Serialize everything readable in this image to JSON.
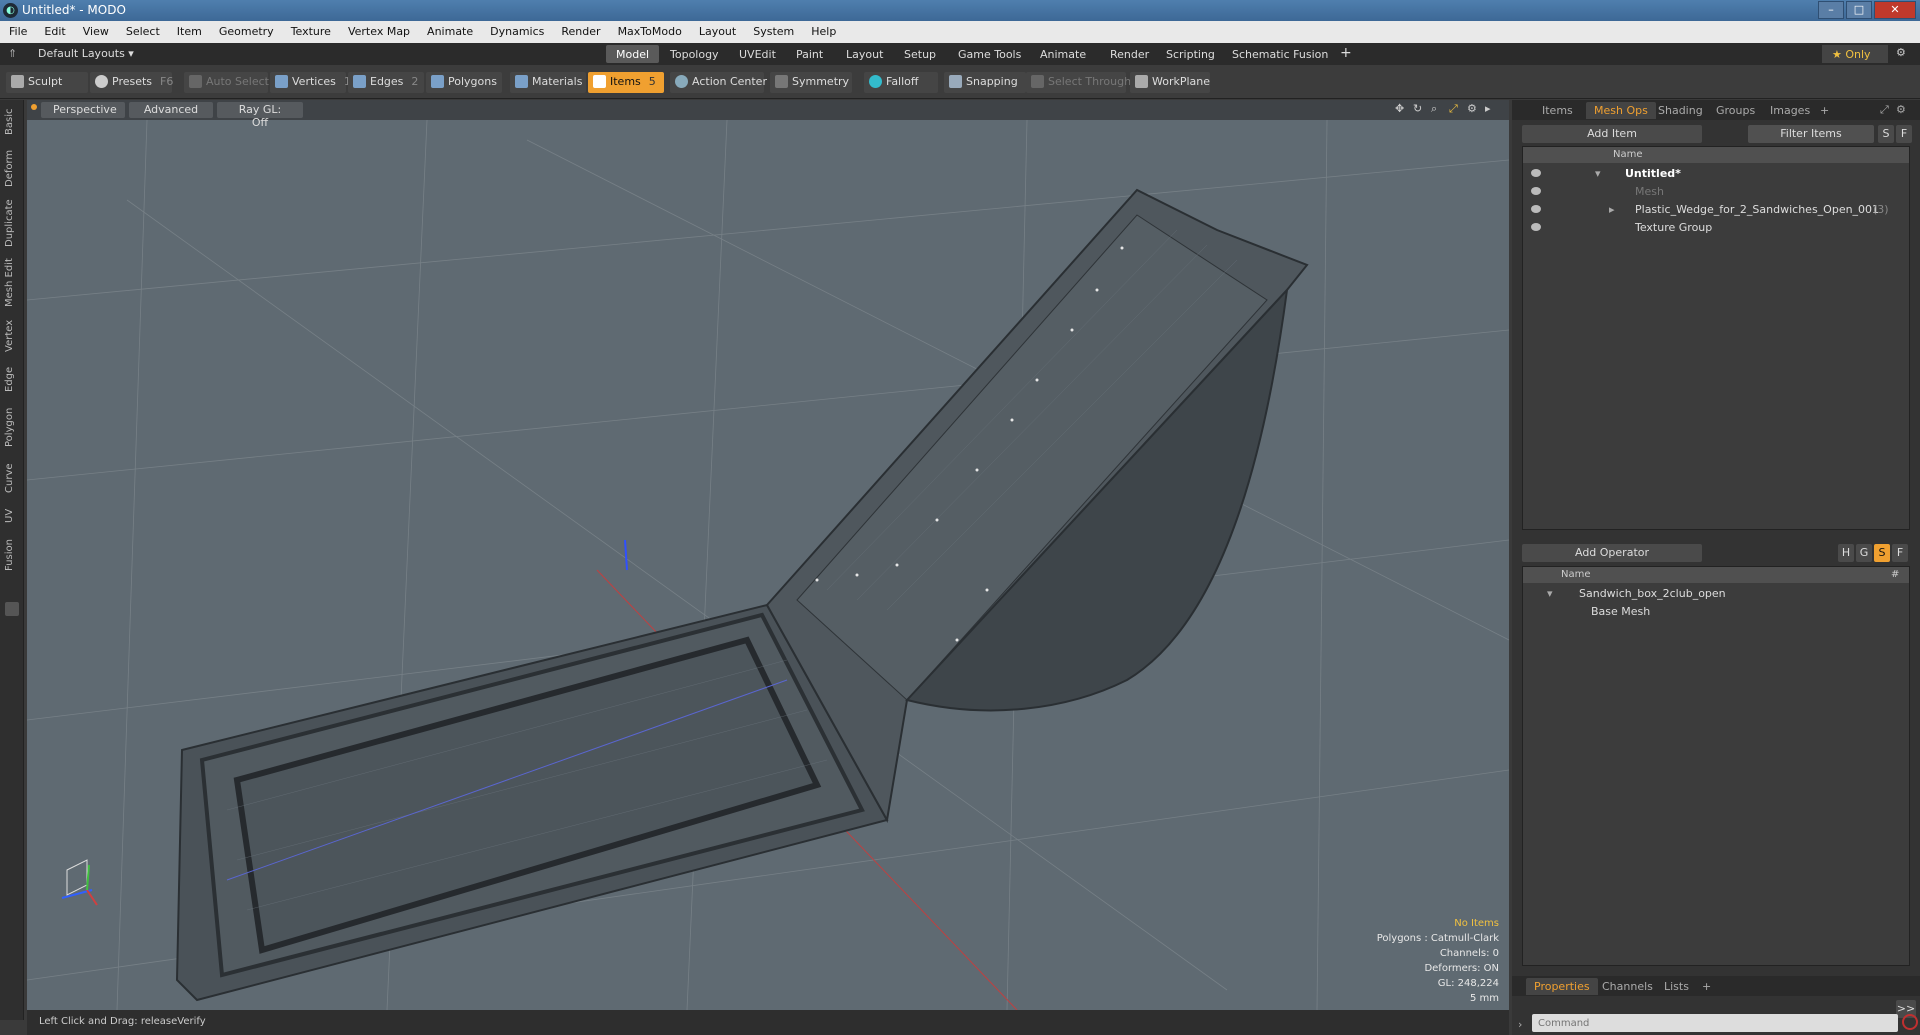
{
  "window": {
    "title": "Untitled* - MODO",
    "min": "–",
    "max": "□",
    "close": "✕"
  },
  "menu": [
    "File",
    "Edit",
    "View",
    "Select",
    "Item",
    "Geometry",
    "Texture",
    "Vertex Map",
    "Animate",
    "Dynamics",
    "Render",
    "MaxToModo",
    "Layout",
    "System",
    "Help"
  ],
  "layout": {
    "name": "Default Layouts ▾",
    "only": "★ Only",
    "tabs": [
      "Model",
      "Topology",
      "UVEdit",
      "Paint",
      "Layout",
      "Setup",
      "Game Tools",
      "Animate",
      "Render",
      "Scripting",
      "Schematic Fusion",
      "+"
    ]
  },
  "toolbar": {
    "sculpt": "Sculpt",
    "presets": "Presets",
    "presets_key": "F6",
    "auto_select": "Auto Select",
    "vertices": "Vertices",
    "vertices_n": "1",
    "edges": "Edges",
    "edges_n": "2",
    "polygons": "Polygons",
    "materials": "Materials",
    "items": "Items",
    "items_n": "5",
    "action_center": "Action Center",
    "symmetry": "Symmetry",
    "falloff": "Falloff",
    "snapping": "Snapping",
    "select_through": "Select Through",
    "workplane": "WorkPlane"
  },
  "side_tabs": [
    "Basic",
    "Deform",
    "Duplicate",
    "Mesh Edit",
    "Vertex",
    "Edge",
    "Polygon",
    "Curve",
    "UV",
    "Fusion"
  ],
  "viewport": {
    "perspective": "Perspective",
    "advanced": "Advanced",
    "raygl": "Ray GL: Off",
    "info": {
      "items": "No Items",
      "polygons": "Polygons : Catmull-Clark",
      "channels": "Channels: 0",
      "deformers": "Deformers: ON",
      "gl": "GL: 248,224",
      "scale": "5 mm"
    }
  },
  "status": {
    "text": "Left Click and Drag:   releaseVerify"
  },
  "items_panel": {
    "tabs": [
      "Items",
      "Mesh Ops",
      "Shading",
      "Groups",
      "Images",
      "+"
    ],
    "add_item": "Add Item",
    "filter": "Filter Items",
    "s": "S",
    "f": "F",
    "col_name": "Name",
    "rows": [
      {
        "label": "Untitled*"
      },
      {
        "label": "Mesh"
      },
      {
        "label": "Plastic_Wedge_for_2_Sandwiches_Open_001",
        "count": "(3)"
      },
      {
        "label": "Texture Group"
      }
    ]
  },
  "meshops_panel": {
    "add_operator": "Add Operator",
    "h": "H",
    "g": "G",
    "s": "S",
    "f": "F",
    "col_name": "Name",
    "col_hash": "#",
    "rows": [
      {
        "label": "Sandwich_box_2club_open"
      },
      {
        "label": "Base Mesh"
      }
    ]
  },
  "properties_panel": {
    "tabs": [
      "Properties",
      "Channels",
      "Lists",
      "+"
    ],
    "expand": ">>",
    "command_placeholder": "Command"
  },
  "colors": {
    "accent": "#f0a030",
    "viewport_bg": "#5f6a72"
  }
}
